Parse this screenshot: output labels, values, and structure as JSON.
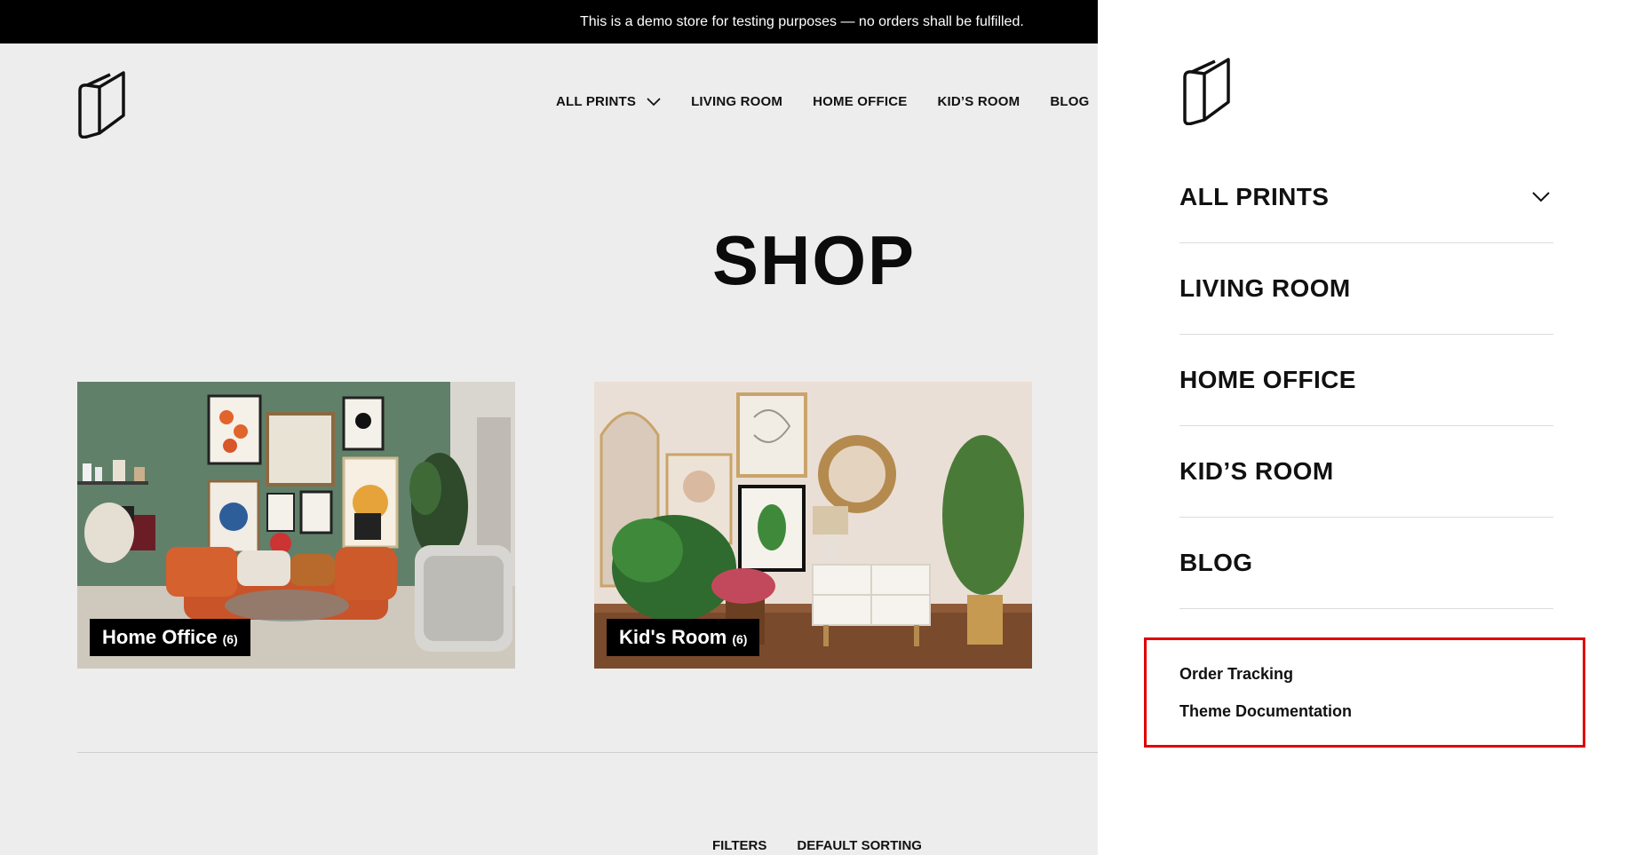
{
  "demo_notice": "This is a demo store for testing purposes — no orders shall be fulfilled.",
  "main_nav": {
    "items": [
      {
        "label": "ALL PRINTS",
        "has_dropdown": true
      },
      {
        "label": "LIVING ROOM"
      },
      {
        "label": "HOME OFFICE"
      },
      {
        "label": "KID’S ROOM"
      },
      {
        "label": "BLOG"
      }
    ]
  },
  "page": {
    "title": "SHOP",
    "categories": [
      {
        "name": "Home Office",
        "count": "(6)"
      },
      {
        "name": "Kid's Room",
        "count": "(6)"
      }
    ],
    "filters_label": "FILTERS",
    "sorting_label": "DEFAULT SORTING"
  },
  "drawer": {
    "items": [
      {
        "label": "ALL PRINTS",
        "has_dropdown": true
      },
      {
        "label": "LIVING ROOM"
      },
      {
        "label": "HOME OFFICE"
      },
      {
        "label": "KID’S ROOM"
      },
      {
        "label": "BLOG"
      }
    ],
    "secondary_links": [
      "Order Tracking",
      "Theme Documentation"
    ]
  },
  "colors": {
    "demo_bar_bg": "#000000",
    "page_bg": "#ededed",
    "drawer_bg": "#ffffff",
    "highlight_box": "#e00000",
    "filter_underline": "#e2a63a"
  }
}
